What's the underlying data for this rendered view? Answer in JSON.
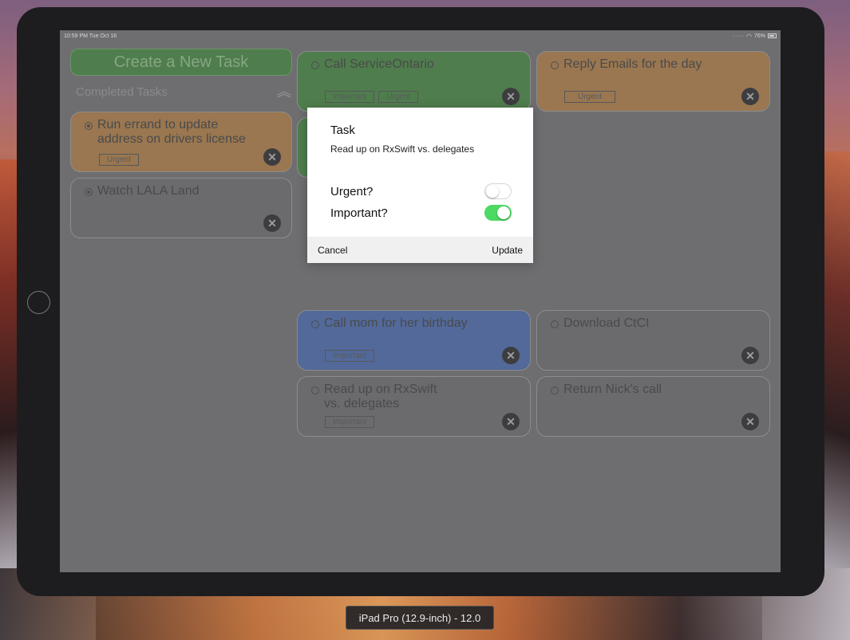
{
  "statusbar": {
    "time": "10:59 PM  Tue Oct 16",
    "battery": "76%"
  },
  "sidebar": {
    "create_button": "Create a New Task",
    "completed_header": "Completed Tasks",
    "completed_tasks": [
      {
        "title": "Run errand to update address on drivers license",
        "tags": [
          "Urgent"
        ],
        "color": "#9a7750"
      },
      {
        "title": "Watch LALA Land",
        "tags": [],
        "color": "#6b6b6d"
      }
    ]
  },
  "tasks": [
    {
      "title": "Call ServiceOntario",
      "tags": [
        "Important",
        "Urgent"
      ],
      "color": "#4f7d4d"
    },
    {
      "title": "Reply Emails for the day",
      "tags": [
        "Urgent"
      ],
      "color": "#9a7750"
    },
    {
      "title": "Call mom for her birthday",
      "tags": [
        "Important"
      ],
      "color": "#52699a"
    },
    {
      "title": "Download CtCI",
      "tags": [],
      "color": "#6b6b6d"
    },
    {
      "title": "Read up on RxSwift vs. delegates",
      "tags": [
        "Important"
      ],
      "color": "#6b6b6d"
    },
    {
      "title": "Return Nick's call",
      "tags": [],
      "color": "#6b6b6d"
    }
  ],
  "dialog": {
    "title": "Task",
    "task_text": "Read up on RxSwift vs. delegates",
    "urgent_label": "Urgent?",
    "urgent_on": false,
    "important_label": "Important?",
    "important_on": true,
    "cancel_label": "Cancel",
    "update_label": "Update"
  },
  "simulator": {
    "device_label": "iPad Pro (12.9-inch) - 12.0"
  },
  "icons": {
    "delete": "x-circle-icon",
    "collapse": "double-chevron-up-icon",
    "radio": "radio-icon"
  }
}
